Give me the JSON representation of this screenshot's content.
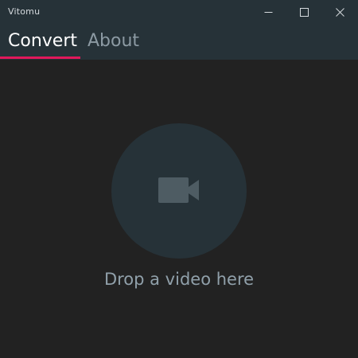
{
  "window": {
    "title": "Vitomu",
    "controls": [
      "minimize-icon",
      "maximize-icon",
      "close-icon"
    ]
  },
  "tabs": [
    {
      "label": "Convert",
      "active": true
    },
    {
      "label": "About",
      "active": false
    }
  ],
  "dropzone": {
    "icon": "video-camera-icon",
    "text": "Drop a video here"
  },
  "colors": {
    "header_bg": "#263238",
    "body_bg": "#222222",
    "accent": "#e0185b",
    "active_tab": "#ffffff",
    "inactive_tab": "#8c9aa3",
    "circle_bg": "#263238",
    "icon": "#4e5c63",
    "drop_text": "#90a0aa"
  }
}
